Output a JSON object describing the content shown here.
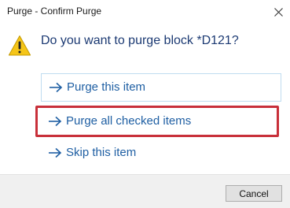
{
  "window": {
    "title": "Purge - Confirm Purge",
    "close_icon": "close-icon"
  },
  "dialog": {
    "icon": "warning-icon",
    "question": "Do you want to purge block *D121?",
    "options": [
      {
        "label": "Purge this item",
        "icon": "arrow-right-icon",
        "state": "hover"
      },
      {
        "label": "Purge all checked items",
        "icon": "arrow-right-icon",
        "state": "highlighted"
      },
      {
        "label": "Skip this item",
        "icon": "arrow-right-icon",
        "state": "normal"
      }
    ]
  },
  "footer": {
    "cancel_label": "Cancel"
  },
  "colors": {
    "link": "#1f5fa3",
    "question": "#1c3a73",
    "highlight_border": "#c8303a",
    "warning_fill": "#f5c518"
  }
}
